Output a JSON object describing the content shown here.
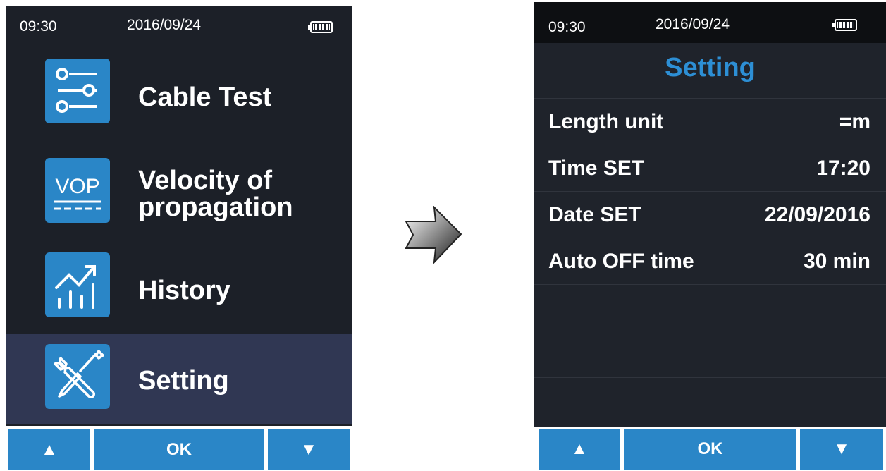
{
  "left_screen": {
    "status": {
      "time": "09:30",
      "date": "2016/09/24"
    },
    "menu": [
      {
        "label_line1": "Cable Test",
        "label_line2": "",
        "icon": "cable-test-sliders-icon"
      },
      {
        "label_line1": "Velocity of",
        "label_line2": "propagation",
        "icon": "vop-icon",
        "icon_text": "VOP"
      },
      {
        "label_line1": "History",
        "label_line2": "",
        "icon": "history-chart-icon"
      },
      {
        "label_line1": "Setting",
        "label_line2": "",
        "icon": "wrench-screwdriver-icon"
      }
    ],
    "selected_index": 3,
    "buttons": {
      "up": "▲",
      "ok": "OK",
      "down": "▼"
    }
  },
  "right_screen": {
    "status": {
      "time": "09:30",
      "date": "2016/09/24"
    },
    "title": "Setting",
    "rows": [
      {
        "label": "Length unit",
        "value": "=m"
      },
      {
        "label": "Time SET",
        "value": "17:20"
      },
      {
        "label": "Date SET",
        "value": "22/09/2016"
      },
      {
        "label": "Auto OFF time",
        "value": "30 min"
      }
    ],
    "buttons": {
      "up": "▲",
      "ok": "OK",
      "down": "▼"
    }
  },
  "colors": {
    "screen_bg": "#1c2028",
    "accent_blue": "#2a86c7",
    "selected_row": "#303753",
    "title_blue": "#2d8fd5"
  }
}
